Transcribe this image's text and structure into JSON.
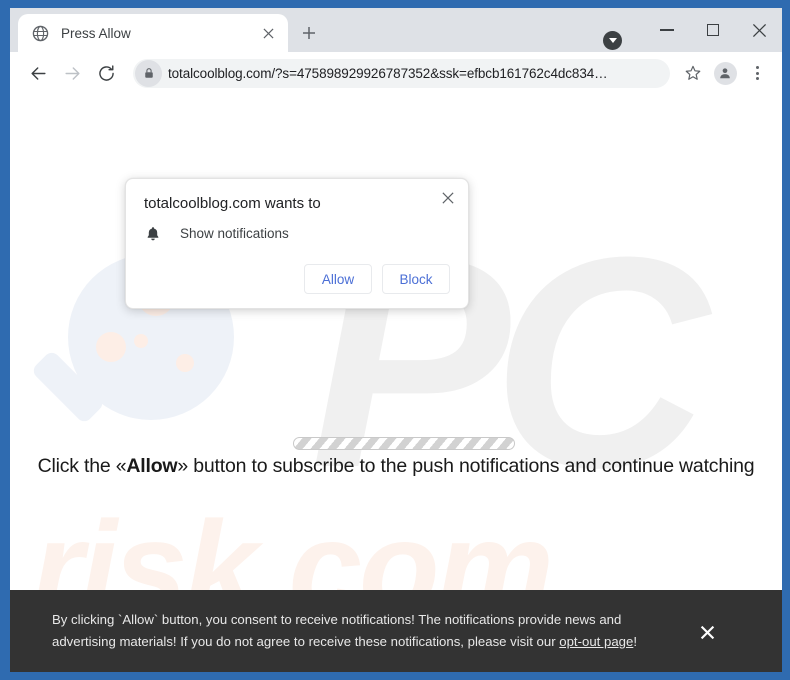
{
  "window": {
    "frame_color": "#2f6bb0",
    "controls": {
      "minimize": "minimize",
      "maximize": "maximize",
      "close": "close"
    }
  },
  "tabstrip": {
    "tab": {
      "title": "Press Allow",
      "favicon": "globe-icon",
      "close_label": "✕"
    },
    "new_tab_label": "+",
    "tab_search_label": "tab-search"
  },
  "toolbar": {
    "back_label": "Back",
    "forward_label": "Forward",
    "reload_label": "Reload",
    "lock_icon": "lock-icon",
    "url": "totalcoolblog.com/?s=475898929926787352&ssk=efbcb161762c4dc834…",
    "bookmark_label": "Bookmark this tab",
    "profile_label": "Profile",
    "menu_label": "Customize and control Google Chrome"
  },
  "permission_dialog": {
    "title": "totalcoolblog.com wants to",
    "permission_icon": "bell-icon",
    "permission_label": "Show notifications",
    "allow_label": "Allow",
    "block_label": "Block",
    "close_label": "✕",
    "button_text_color": "#4b6fd6"
  },
  "page": {
    "watermark_pc": "PC",
    "watermark_risk": "risk.com",
    "progress_label": "loading-progress",
    "instruction_prefix": "Click the «Allow»",
    "instruction_pre": "Click the «",
    "instruction_bold": "Allow",
    "instruction_post": "» button to subscribe to the push notifications and continue watching"
  },
  "banner": {
    "text_part1": "By clicking `Allow` button, you consent to receive notifications! The notifications provide news and advertising materials! If you do not agree to receive these notifications, please visit our ",
    "link_text": "opt-out page",
    "text_part2": "!",
    "close_label": "✕",
    "background": "#333333"
  }
}
